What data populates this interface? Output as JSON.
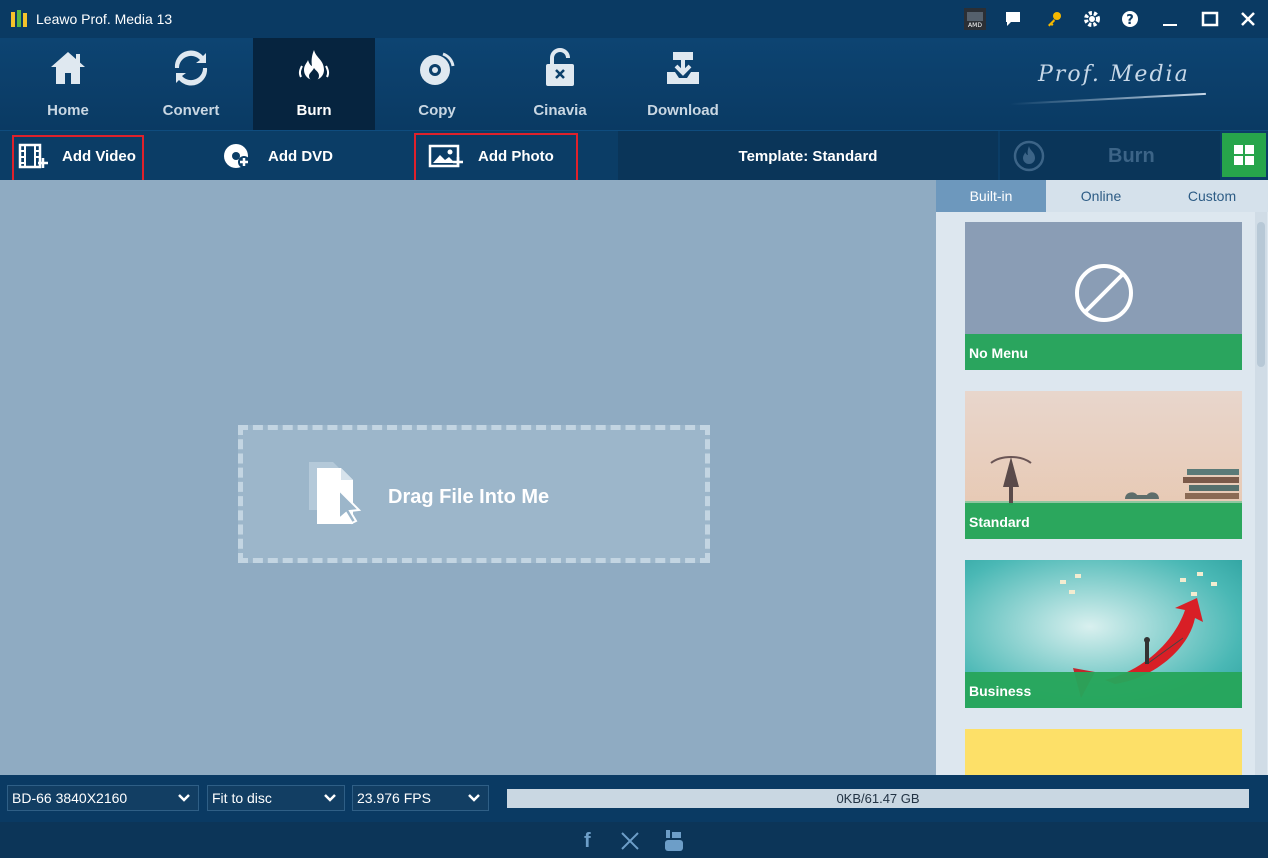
{
  "window": {
    "title": "Leawo Prof. Media 13"
  },
  "nav": {
    "items": [
      {
        "label": "Home"
      },
      {
        "label": "Convert"
      },
      {
        "label": "Burn"
      },
      {
        "label": "Copy"
      },
      {
        "label": "Cinavia"
      },
      {
        "label": "Download"
      }
    ],
    "active": "Burn",
    "brand": "Prof. Media"
  },
  "toolbar": {
    "add_video": "Add Video",
    "add_dvd": "Add DVD",
    "add_photo": "Add Photo",
    "template": "Template: Standard",
    "burn": "Burn"
  },
  "main": {
    "drop_text": "Drag File Into Me"
  },
  "panel": {
    "tabs": [
      "Built-in",
      "Online",
      "Custom"
    ],
    "active_tab": "Built-in",
    "templates": [
      "No Menu",
      "Standard",
      "Business",
      ""
    ]
  },
  "bottom": {
    "disc": "BD-66 3840X2160",
    "fit": "Fit to disc",
    "fps": "23.976 FPS",
    "usage": "0KB/61.47 GB",
    "usage_fraction": 0
  },
  "colors": {
    "accent_green": "#27a54b",
    "highlight_red": "#e0212b",
    "nav_bg": "#0a3a63"
  }
}
